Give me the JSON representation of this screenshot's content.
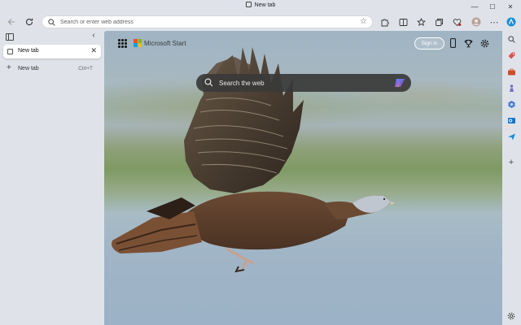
{
  "window": {
    "title": "New tab",
    "controls": {
      "minimize": "—",
      "maximize": "☐",
      "close": "✕"
    }
  },
  "toolbar": {
    "address_placeholder": "Search or enter web address",
    "back_icon": "arrow-left-icon",
    "refresh_icon": "refresh-icon",
    "more_label": "⋯"
  },
  "sidebar": {
    "tabs": [
      {
        "label": "New tab",
        "close": "✕"
      }
    ],
    "new_tab": {
      "label": "New tab",
      "shortcut": "Ctrl+T",
      "plus": "+"
    },
    "collapse": "‹"
  },
  "newtab_page": {
    "brand": "Microsoft Start",
    "brand_colors": [
      "#f25022",
      "#7fba00",
      "#00a4ef",
      "#ffb900"
    ],
    "search_placeholder": "Search the web",
    "signin_label": "Sign in"
  },
  "colors": {
    "chrome": "#dfe3e9",
    "search_box": "#3a3a3a",
    "accent": "#0078d4"
  }
}
